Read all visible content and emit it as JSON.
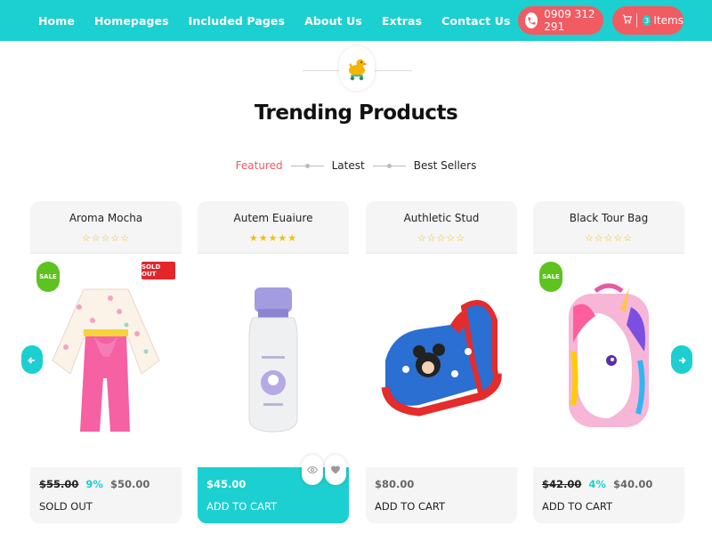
{
  "nav": {
    "links": [
      "Home",
      "Homepages",
      "Included Pages",
      "About Us",
      "Extras",
      "Contact Us"
    ],
    "phone": "0909 312 291",
    "cart_count": "3",
    "cart_label": "Items"
  },
  "section": {
    "logo_icon": "duck-toy-icon",
    "title": "Trending Products",
    "tabs": [
      "Featured",
      "Latest",
      "Best Sellers"
    ],
    "active_tab": "Featured"
  },
  "products": [
    {
      "name": "Aroma Mocha",
      "rating": 0,
      "stars": "☆☆☆☆☆",
      "old_price": "$55.00",
      "discount": "9%",
      "price": "$50.00",
      "action": "SOLD OUT",
      "badges": [
        "SALE",
        "SOLD OUT"
      ]
    },
    {
      "name": "Autem Euaiure",
      "rating": 5,
      "stars": "★★★★★",
      "price": "$45.00",
      "action": "ADD TO CART"
    },
    {
      "name": "Authletic Stud",
      "rating": 0,
      "stars": "☆☆☆☆☆",
      "price": "$80.00",
      "action": "ADD TO CART"
    },
    {
      "name": "Black Tour Bag",
      "rating": 0,
      "stars": "☆☆☆☆☆",
      "old_price": "$42.00",
      "discount": "4%",
      "price": "$40.00",
      "action": "ADD TO CART",
      "badges": [
        "SALE"
      ]
    }
  ],
  "colors": {
    "accent": "#1ccfd0",
    "highlight": "#f15b62",
    "sale": "#5ec21f",
    "sold_out": "#e4262a"
  }
}
